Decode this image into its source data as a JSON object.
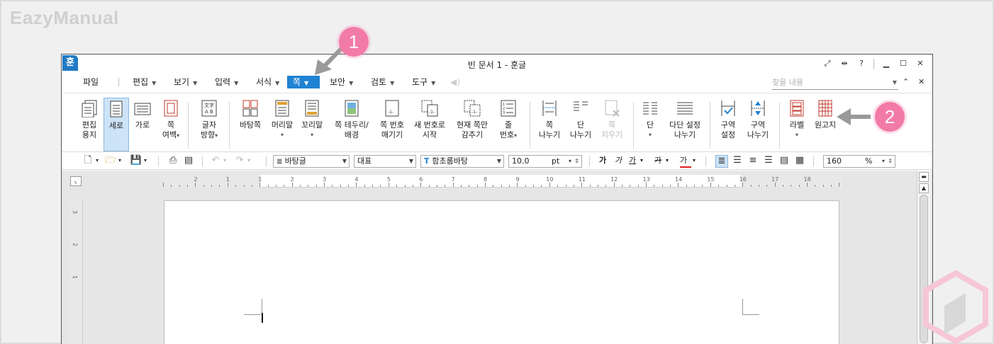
{
  "watermark": "EazyManual",
  "window": {
    "app_logo": "훈",
    "title": "빈 문서 1 - 훈글",
    "title_icons": [
      "fullscreen-icon",
      "width-icon",
      "?",
      "minimize-icon",
      "maximize-icon",
      "close-icon"
    ],
    "help_label": "?"
  },
  "menubar": {
    "file": "파일",
    "items": [
      "편집",
      "보기",
      "입력",
      "서식",
      "쪽",
      "보안",
      "검토",
      "도구"
    ],
    "active": "쪽",
    "search_placeholder": "찾을 내용"
  },
  "ribbon": {
    "groups": [
      {
        "id": "paper",
        "label1": "편집",
        "label2": "용지"
      },
      {
        "id": "portrait",
        "label1": "세로",
        "label2": ""
      },
      {
        "id": "landscape",
        "label1": "가로",
        "label2": ""
      },
      {
        "id": "margin",
        "label1": "쪽",
        "label2": "여백"
      },
      {
        "id": "text-direction",
        "label1": "글자",
        "label2": "방향"
      },
      {
        "id": "master-page",
        "label1": "바탕쪽",
        "label2": ""
      },
      {
        "id": "header",
        "label1": "머리말",
        "label2": ""
      },
      {
        "id": "footer",
        "label1": "꼬리말",
        "label2": ""
      },
      {
        "id": "border",
        "label1": "쪽 테두리/",
        "label2": "배경"
      },
      {
        "id": "page-number",
        "label1": "쪽 번호",
        "label2": "매기기"
      },
      {
        "id": "new-number",
        "label1": "새 번호로",
        "label2": "시작"
      },
      {
        "id": "hide-page",
        "label1": "현재 쪽만",
        "label2": "감추기"
      },
      {
        "id": "line-number",
        "label1": "줄",
        "label2": "번호"
      },
      {
        "id": "page-break",
        "label1": "쪽",
        "label2": "나누기"
      },
      {
        "id": "column-break",
        "label1": "단",
        "label2": "나누기"
      },
      {
        "id": "page-delete",
        "label1": "쪽",
        "label2": "지우기"
      },
      {
        "id": "column",
        "label1": "단",
        "label2": ""
      },
      {
        "id": "multi-column",
        "label1": "다단 설정",
        "label2": "나누기"
      },
      {
        "id": "section-setting",
        "label1": "구역",
        "label2": "설정"
      },
      {
        "id": "section-break",
        "label1": "구역",
        "label2": "나누기"
      },
      {
        "id": "label",
        "label1": "라벨",
        "label2": ""
      },
      {
        "id": "manuscript",
        "label1": "원고지",
        "label2": ""
      }
    ]
  },
  "toolbar2": {
    "style": "바탕글",
    "style_set": "대표",
    "font": "함초롬바탕",
    "font_size": "10.0",
    "unit": "pt",
    "zoom": "160",
    "zoom_unit": "%",
    "format_buttons": [
      "가",
      "가",
      "가",
      "가",
      "가"
    ]
  },
  "ruler": {
    "numbers": [
      "2",
      "1",
      "1",
      "2",
      "3",
      "4",
      "5",
      "6",
      "7",
      "8",
      "9",
      "10",
      "11",
      "12",
      "13",
      "14",
      "15",
      "16",
      "17",
      "18"
    ],
    "v_numbers": [
      "3",
      "2",
      "1"
    ]
  },
  "callouts": [
    "1",
    "2"
  ],
  "colors": {
    "accent": "#1f82d2",
    "callout": "#f27aa7",
    "selected": "#cde3f7"
  }
}
